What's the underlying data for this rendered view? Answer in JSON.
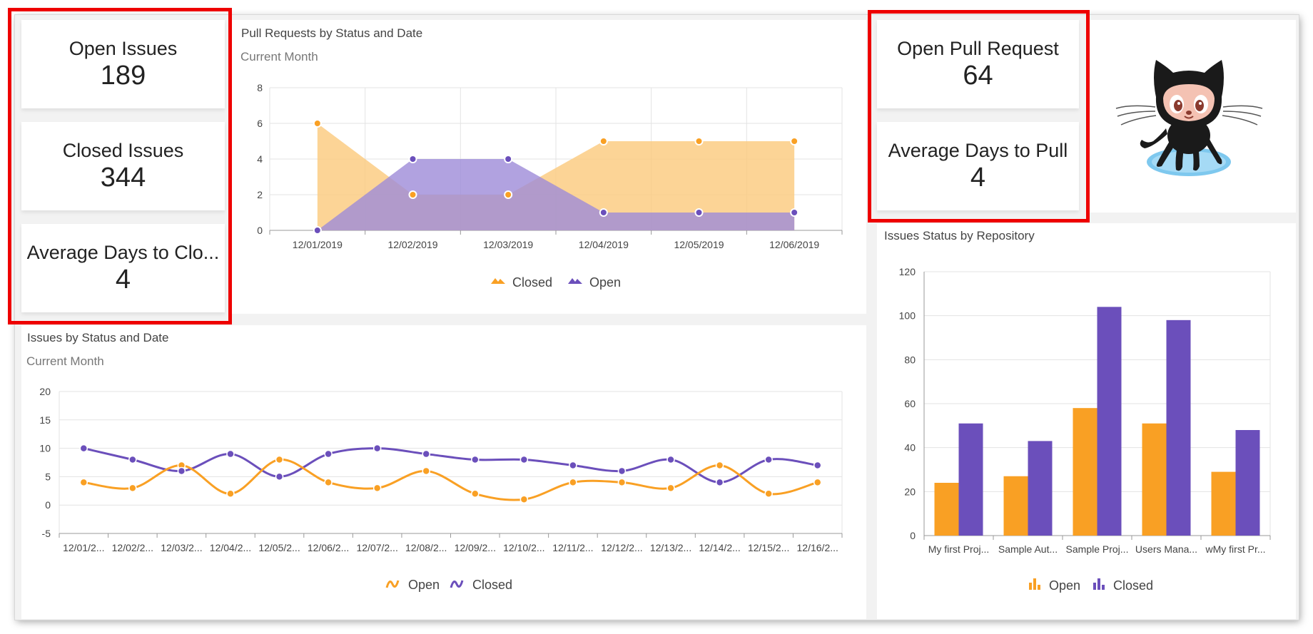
{
  "kpis_left": [
    {
      "label": "Open Issues",
      "value": "189"
    },
    {
      "label": "Closed Issues",
      "value": "344"
    },
    {
      "label": "Average Days to Clo...",
      "value": "4"
    }
  ],
  "kpis_right": [
    {
      "label": "Open Pull Request",
      "value": "64"
    },
    {
      "label": "Average Days to Pull",
      "value": "4"
    }
  ],
  "mascot_icon": "github-octocat-icon",
  "colors": {
    "orange": "#f9a024",
    "orange_fill": "#fbc97c",
    "purple": "#6b4fbb",
    "purple_fill": "#9d8bd8",
    "highlight": "#ee0000"
  },
  "pull_requests": {
    "title": "Pull Requests by Status and Date",
    "subtitle": "Current Month"
  },
  "issues_by_date": {
    "title": "Issues by Status and Date",
    "subtitle": "Current Month"
  },
  "issues_by_repo": {
    "title": "Issues Status by Repository"
  },
  "chart_data": [
    {
      "type": "area",
      "title": "Pull Requests by Status and Date",
      "categories": [
        "12/01/2019",
        "12/02/2019",
        "12/03/2019",
        "12/04/2019",
        "12/05/2019",
        "12/06/2019"
      ],
      "series": [
        {
          "name": "Closed",
          "values": [
            6,
            2,
            2,
            5,
            5,
            5
          ],
          "color": "#f9a024"
        },
        {
          "name": "Open",
          "values": [
            0,
            4,
            4,
            1,
            1,
            1
          ],
          "color": "#6b4fbb"
        }
      ],
      "ylim": [
        0,
        8
      ],
      "yticks": [
        0,
        2,
        4,
        6,
        8
      ],
      "grid": true,
      "legend": "bottom"
    },
    {
      "type": "line",
      "title": "Issues by Status and Date",
      "categories": [
        "12/01/2...",
        "12/02/2...",
        "12/03/2...",
        "12/04/2...",
        "12/05/2...",
        "12/06/2...",
        "12/07/2...",
        "12/08/2...",
        "12/09/2...",
        "12/10/2...",
        "12/11/2...",
        "12/12/2...",
        "12/13/2...",
        "12/14/2...",
        "12/15/2...",
        "12/16/2..."
      ],
      "series": [
        {
          "name": "Open",
          "values": [
            4,
            3,
            7,
            2,
            8,
            4,
            3,
            6,
            2,
            1,
            4,
            4,
            3,
            7,
            2,
            4
          ],
          "color": "#f9a024"
        },
        {
          "name": "Closed",
          "values": [
            10,
            8,
            6,
            9,
            5,
            9,
            10,
            9,
            8,
            8,
            7,
            6,
            8,
            4,
            8,
            7
          ],
          "color": "#6b4fbb"
        }
      ],
      "ylim": [
        -5,
        20
      ],
      "yticks": [
        -5,
        0,
        5,
        10,
        15,
        20
      ],
      "grid": true,
      "legend": "bottom"
    },
    {
      "type": "bar",
      "title": "Issues Status by Repository",
      "categories": [
        "My first Proj...",
        "Sample Aut...",
        "Sample Proj...",
        "Users Mana...",
        "wMy first Pr..."
      ],
      "series": [
        {
          "name": "Open",
          "values": [
            24,
            27,
            58,
            51,
            29
          ],
          "color": "#f9a024"
        },
        {
          "name": "Closed",
          "values": [
            51,
            43,
            104,
            98,
            48
          ],
          "color": "#6b4fbb"
        }
      ],
      "ylim": [
        0,
        120
      ],
      "yticks": [
        0,
        20,
        40,
        60,
        80,
        100,
        120
      ],
      "grid": true,
      "legend": "bottom"
    }
  ]
}
